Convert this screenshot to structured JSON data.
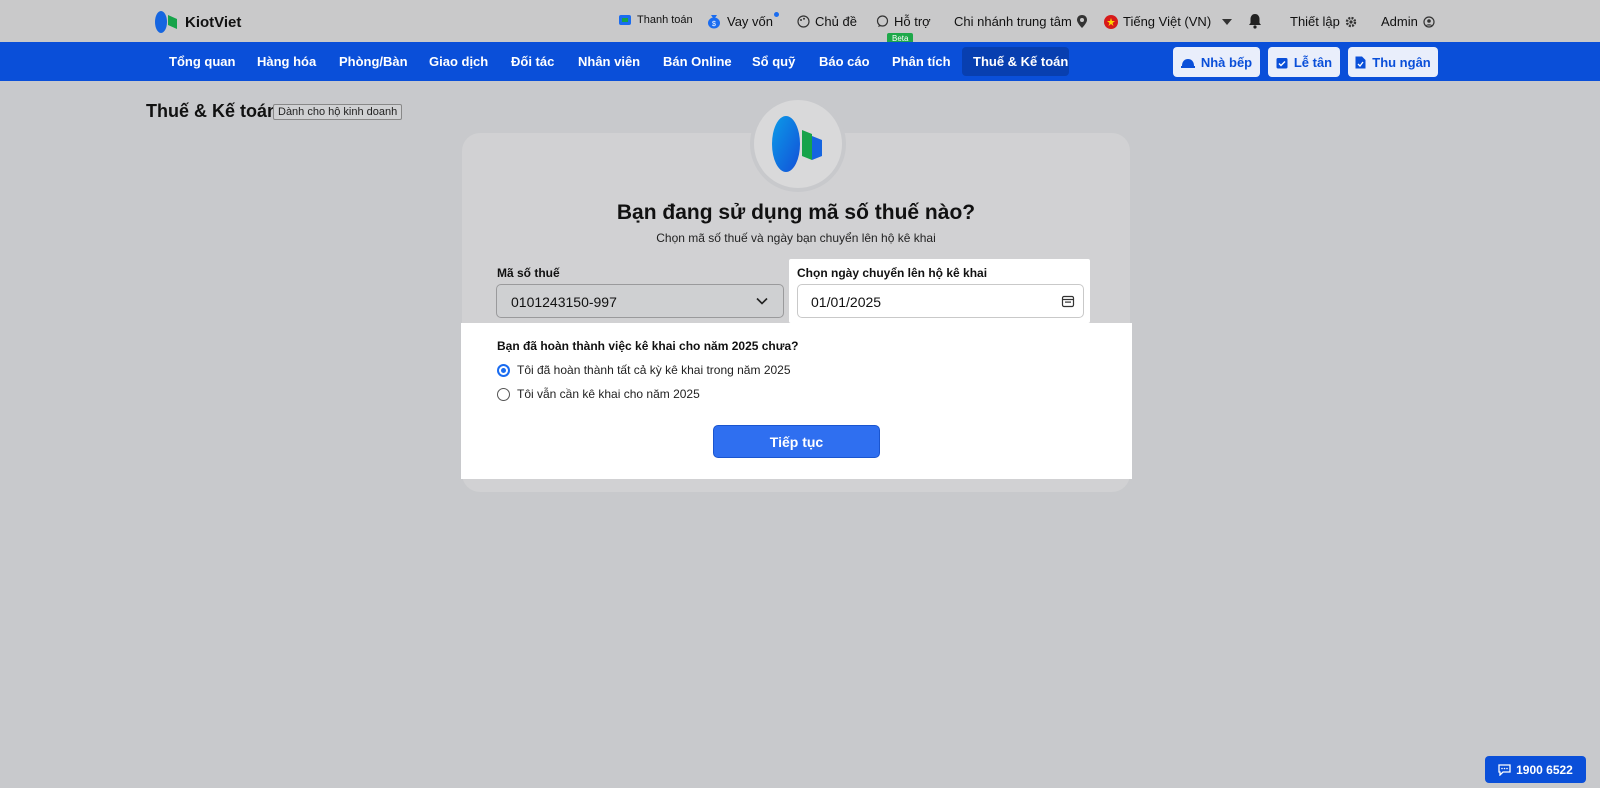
{
  "brand": {
    "name": "KiotViet",
    "logo_colors": [
      "#1565e0",
      "#16a34a"
    ]
  },
  "topbar": {
    "payment": "Thanh toán",
    "loan": "Vay vốn",
    "theme": "Chủ đề",
    "support": "Hỗ trợ",
    "branch": "Chi nhánh trung tâm",
    "language": "Tiếng Việt (VN)",
    "settings": "Thiết lập",
    "user": "Admin",
    "beta_badge": "Beta"
  },
  "mainnav": {
    "items": [
      "Tổng quan",
      "Hàng hóa",
      "Phòng/Bàn",
      "Giao dịch",
      "Đối tác",
      "Nhân viên",
      "Bán Online",
      "Sổ quỹ",
      "Báo cáo",
      "Phân tích",
      "Thuế & Kế toán"
    ],
    "active_index": 10,
    "kitchen": "Nhà bếp",
    "reception": "Lễ tân",
    "cashier": "Thu ngân"
  },
  "page": {
    "title": "Thuế & Kế toán",
    "tag": "Dành cho hộ kinh doanh"
  },
  "form": {
    "heading": "Bạn đang sử dụng mã số thuế nào?",
    "subheading": "Chọn mã số thuế và ngày bạn chuyển lên hộ kê khai",
    "tax_code_label": "Mã số thuế",
    "tax_code_value": "0101243150-997",
    "date_label": "Chọn ngày chuyển lên hộ kê khai",
    "date_value": "01/01/2025",
    "question": "Bạn đã hoàn thành việc kê khai cho năm 2025 chưa?",
    "options": [
      {
        "label": "Tôi đã hoàn thành tất cả kỳ kê khai trong năm 2025",
        "selected": true
      },
      {
        "label": "Tôi vẫn cần kê khai cho năm 2025",
        "selected": false
      }
    ],
    "continue": "Tiếp tục"
  },
  "hotline": "1900 6522",
  "colors": {
    "primary": "#0a4fd9",
    "button": "#2f6ff0",
    "overlay": "#c8c9cc"
  }
}
